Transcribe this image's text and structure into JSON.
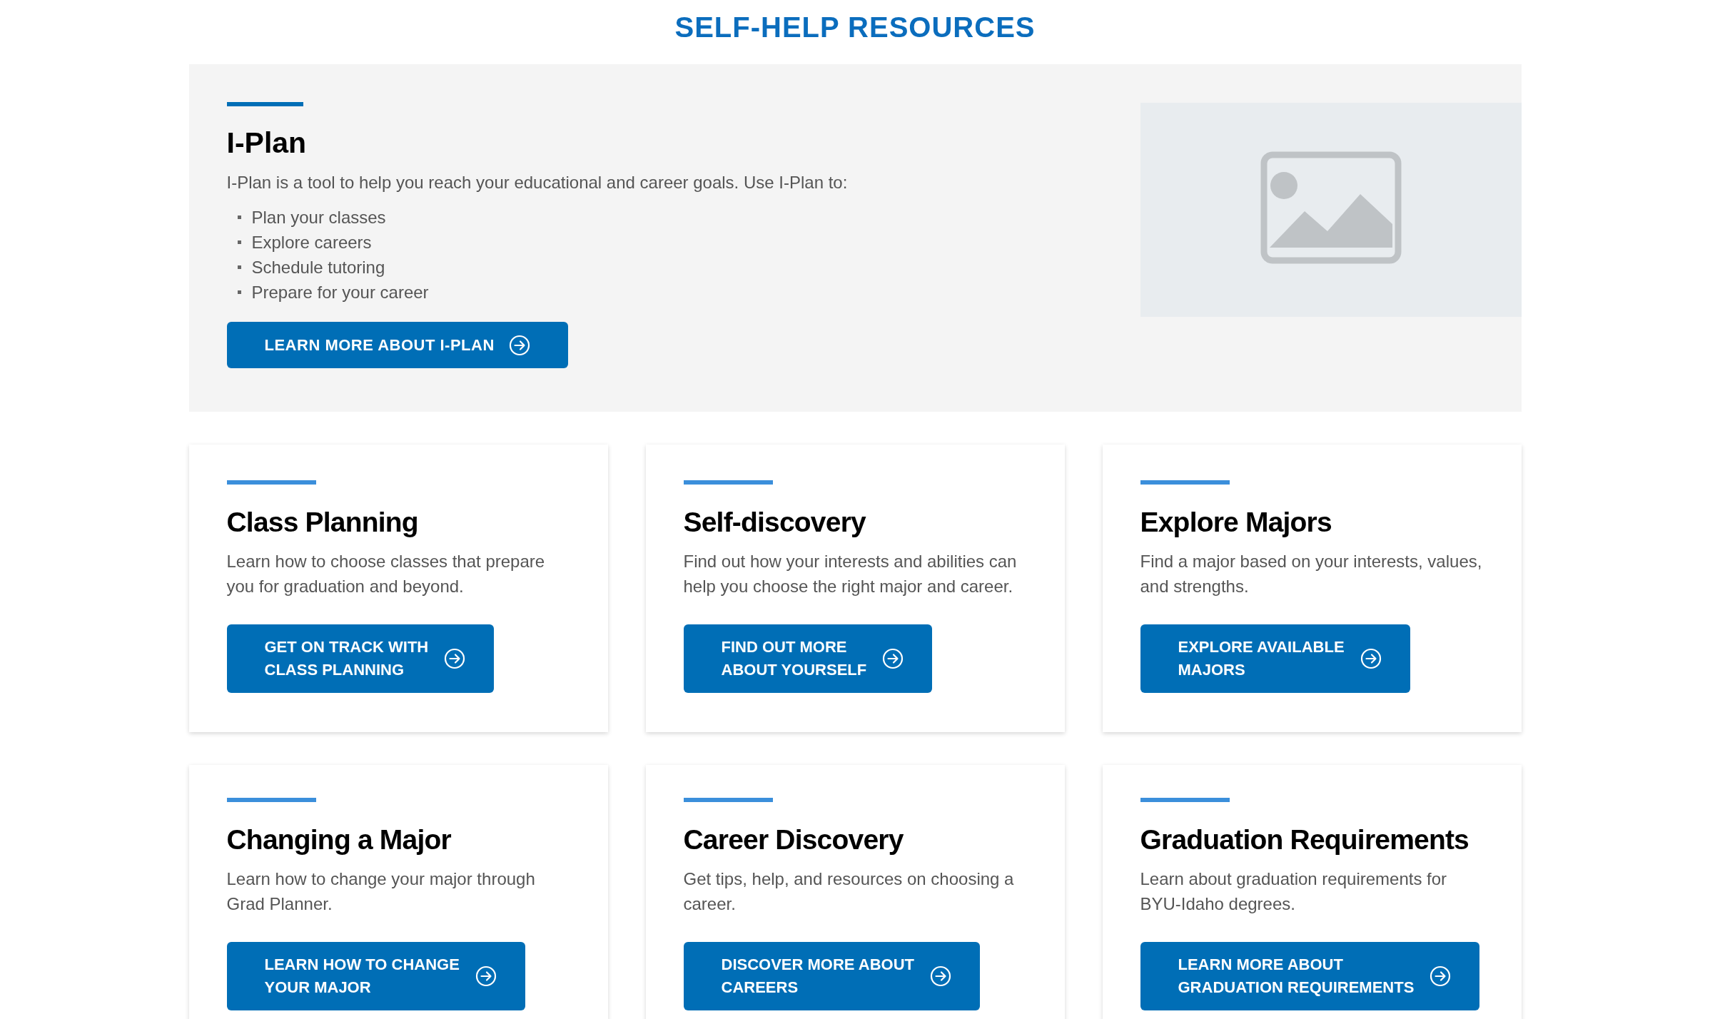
{
  "page_title": "SELF-HELP RESOURCES",
  "feature": {
    "title": "I-Plan",
    "intro": "I-Plan is a tool to help you reach your educational and career goals. Use I-Plan to:",
    "bullets": [
      "Plan your classes",
      "Explore careers",
      "Schedule tutoring",
      "Prepare for your career"
    ],
    "button": "LEARN MORE ABOUT I-PLAN"
  },
  "cards": [
    {
      "title": "Class Planning",
      "description": "Learn how to choose classes that prepare you for graduation and beyond.",
      "button": "GET ON TRACK WITH\nCLASS PLANNING"
    },
    {
      "title": "Self-discovery",
      "description": "Find out how your interests and abilities can help you choose the right major and career.",
      "button": "FIND OUT MORE\nABOUT YOURSELF"
    },
    {
      "title": "Explore Majors",
      "description": "Find a major based on your interests, values, and strengths.",
      "button": "EXPLORE AVAILABLE\nMAJORS"
    },
    {
      "title": "Changing a Major",
      "description": "Learn how to change your major through Grad Planner.",
      "button": "LEARN HOW TO CHANGE\nYOUR MAJOR"
    },
    {
      "title": "Career Discovery",
      "description": "Get tips, help, and resources on choosing a career.",
      "button": "DISCOVER MORE ABOUT\nCAREERS"
    },
    {
      "title": "Graduation Requirements",
      "description": "Learn about graduation requirements for BYU-Idaho degrees.",
      "button": "LEARN MORE ABOUT\nGRADUATION REQUIREMENTS"
    }
  ]
}
